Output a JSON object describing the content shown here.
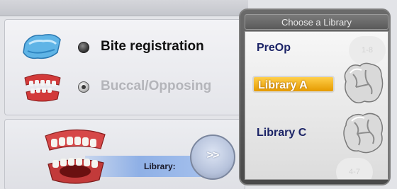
{
  "options": [
    {
      "label": "Bite registration",
      "selected": true,
      "icon": "bite-registration-icon"
    },
    {
      "label": "Buccal/Opposing",
      "selected": false,
      "enabled": false,
      "icon": "buccal-opposing-icon"
    }
  ],
  "library_bar": {
    "label": "Library:",
    "button_label": ">>",
    "icon": "jaw-icon"
  },
  "library_panel": {
    "title": "Choose a Library",
    "items": [
      {
        "label": "PreOp",
        "selected": false
      },
      {
        "label": "Library A",
        "selected": true
      },
      {
        "label": "Library C",
        "selected": false
      }
    ],
    "ghost_labels": [
      "1-8",
      "4-7"
    ]
  },
  "colors": {
    "selected_item": "#f0a800",
    "item_text": "#1b2366",
    "library_bar": "#8fb0e6",
    "panel": "#555555"
  }
}
